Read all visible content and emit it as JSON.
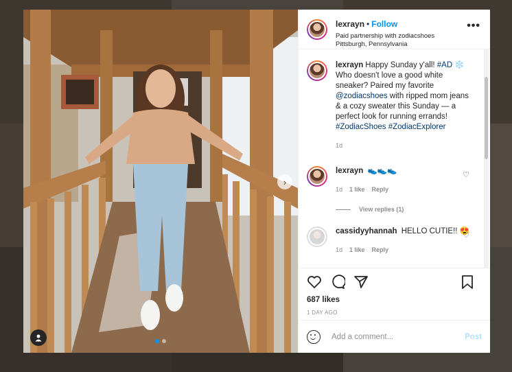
{
  "header": {
    "username": "lexrayn",
    "separator": "•",
    "follow_label": "Follow",
    "partnership": "Paid partnership with zodiacshoes",
    "location": "Pittsburgh, Pennsylvania",
    "more_label": "•••"
  },
  "caption": {
    "username": "lexrayn",
    "text_before": "Happy Sunday y'all! ",
    "hashtag_ad": "#AD",
    "snowflake": "❄️",
    "text_mid1": " Who doesn't love a good white sneaker? Paired my favorite ",
    "mention": "@zodiacshoes",
    "text_mid2": " with ripped mom jeans & a cozy sweater this Sunday — a perfect look for running errands! ",
    "hashtag1": "#ZodiacShoes",
    "hashtag2": "#ZodiacExplorer",
    "time": "1d"
  },
  "comments": [
    {
      "username": "lexrayn",
      "text": "👟👟👟",
      "time": "1d",
      "likes": "1 like",
      "reply": "Reply",
      "view_replies": "View replies (1)"
    },
    {
      "username": "cassidyyhannah",
      "text": "HELLO CUTIE!! 😍",
      "time": "1d",
      "likes": "1 like",
      "reply": "Reply"
    }
  ],
  "actions": {
    "likes": "687 likes",
    "date": "1 DAY AGO"
  },
  "add_comment": {
    "placeholder": "Add a comment...",
    "post_label": "Post"
  },
  "colors": {
    "accent": "#0095f6",
    "link": "#00376b",
    "muted": "#8e8e8e",
    "post_disabled": "#b2dffc"
  }
}
